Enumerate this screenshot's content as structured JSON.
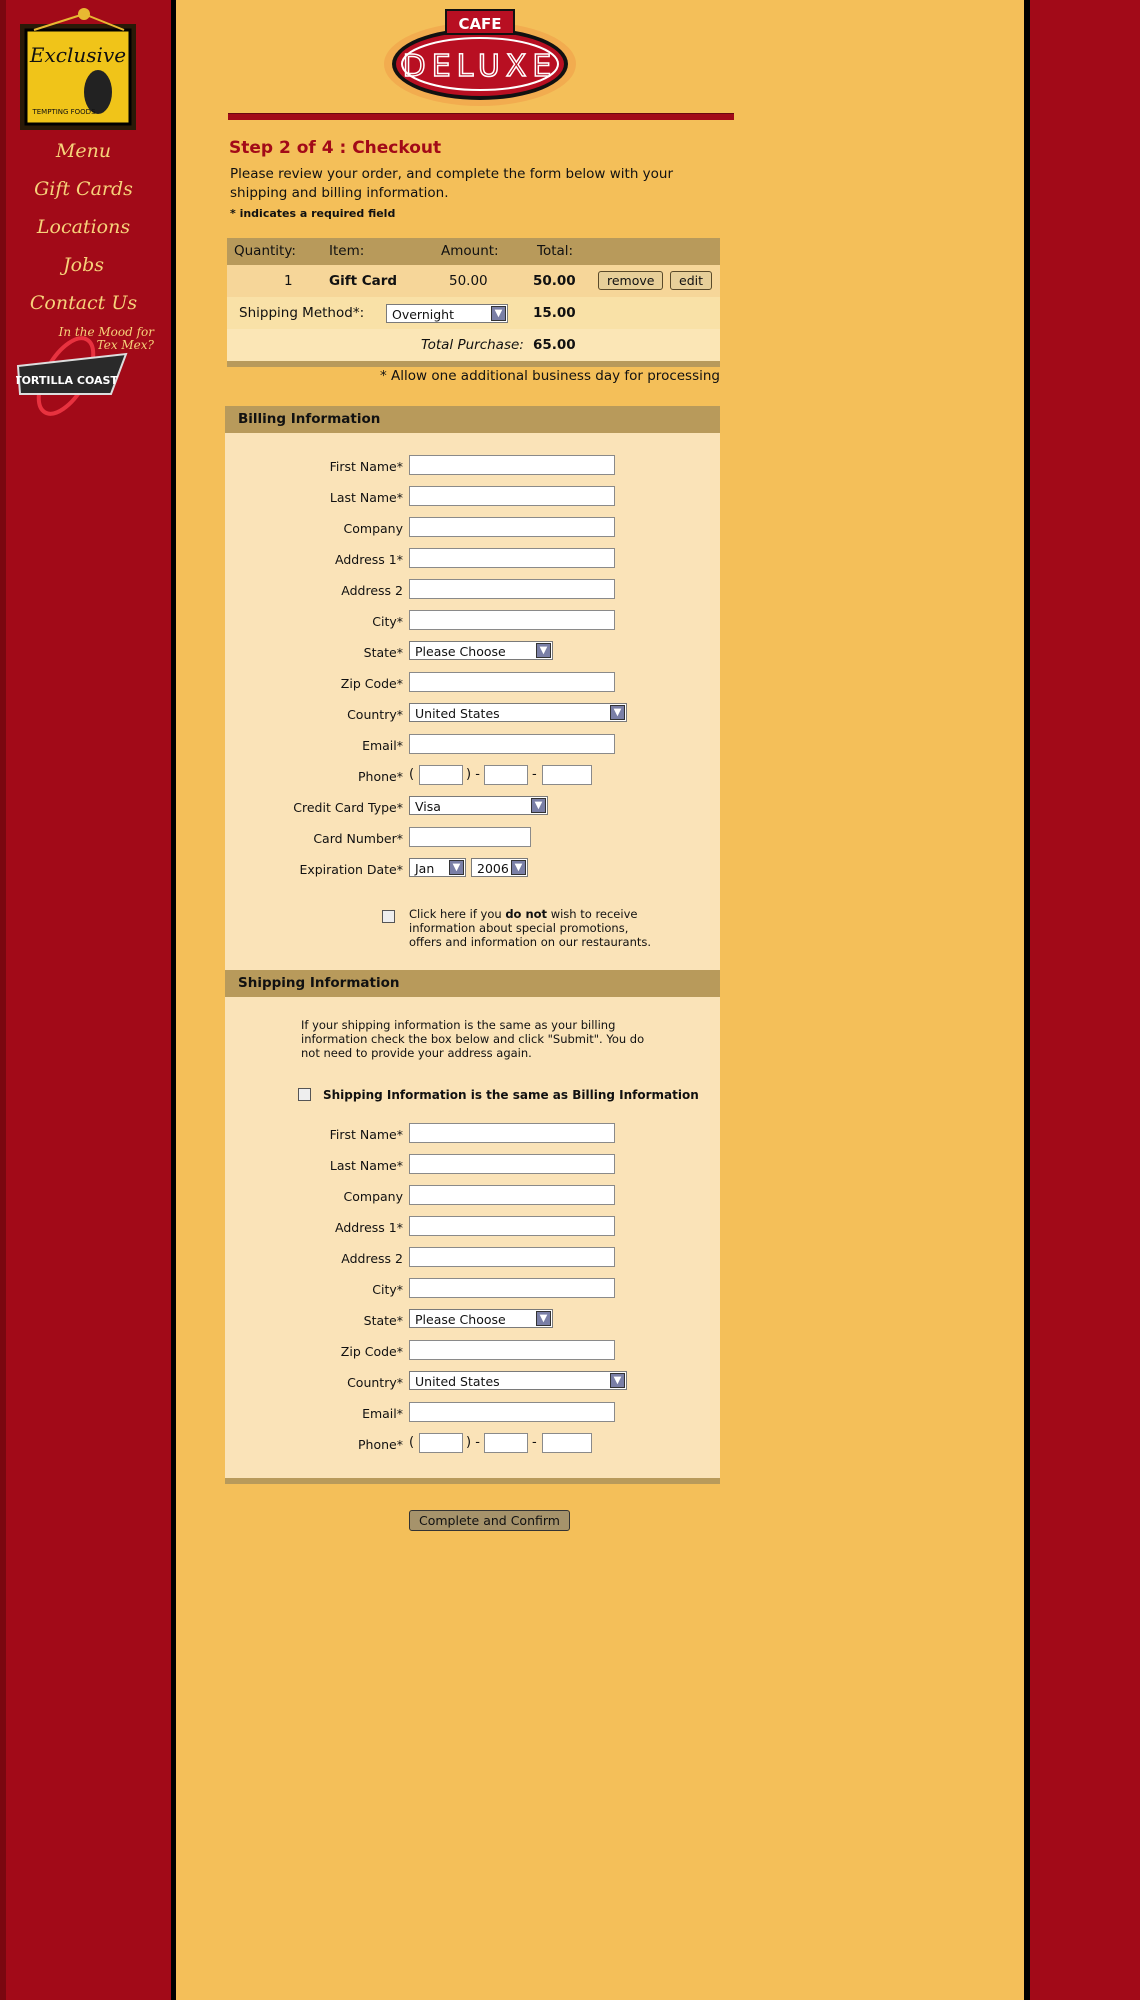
{
  "nav": {
    "items": [
      "Menu",
      "Gift Cards",
      "Locations",
      "Jobs",
      "Contact Us"
    ]
  },
  "logo": {
    "title": "Exclusive",
    "sub": "TEMPTING FOODS"
  },
  "promo": {
    "tagline": "In the Mood for Tex Mex?",
    "name": "TORTILLA COAST"
  },
  "brand": {
    "top": "CAFE",
    "main": "DELUXE"
  },
  "page": {
    "step": "Step 2 of 4 : Checkout",
    "intro": "Please review your order, and complete the form below with your shipping and billing information.",
    "required_note": "* indicates a required field"
  },
  "order": {
    "headers": {
      "quantity": "Quantity:",
      "item": "Item:",
      "amount": "Amount:",
      "total": "Total:"
    },
    "line": {
      "quantity": "1",
      "item": "Gift Card",
      "amount": "50.00",
      "total": "50.00",
      "remove": "remove",
      "edit": "edit"
    },
    "shipping": {
      "label": "Shipping Method*:",
      "value": "Overnight",
      "total": "15.00"
    },
    "purchase": {
      "label": "Total Purchase:",
      "total": "65.00"
    },
    "note": "* Allow one additional business day for processing"
  },
  "billing": {
    "title": "Billing Information",
    "fields": {
      "first_name": "First Name*",
      "last_name": "Last Name*",
      "company": "Company",
      "address1": "Address 1*",
      "address2": "Address 2",
      "city": "City*",
      "state": "State*",
      "state_value": "Please Choose",
      "zip": "Zip Code*",
      "country": "Country*",
      "country_value": "United States",
      "email": "Email*",
      "phone": "Phone*",
      "card_type": "Credit Card Type*",
      "card_type_value": "Visa",
      "card_number": "Card Number*",
      "expiration": "Expiration Date*",
      "exp_month": "Jan",
      "exp_year": "2006"
    },
    "optout_pre": "Click here if you ",
    "optout_bold": "do not",
    "optout_post": " wish to receive information about special promotions, offers and information on our restaurants."
  },
  "shipping": {
    "title": "Shipping Information",
    "intro": "If your shipping information is the same as your billing information check the box below and click \"Submit\". You do not need to provide your address again.",
    "same_label": "Shipping Information is the same as Billing Information",
    "fields": {
      "first_name": "First Name*",
      "last_name": "Last Name*",
      "company": "Company",
      "address1": "Address 1*",
      "address2": "Address 2",
      "city": "City*",
      "state": "State*",
      "state_value": "Please Choose",
      "zip": "Zip Code*",
      "country": "Country*",
      "country_value": "United States",
      "email": "Email*",
      "phone": "Phone*"
    }
  },
  "submit": "Complete and Confirm",
  "phone_sep": {
    "open": "(",
    "close": ") -",
    "dash": "-"
  }
}
